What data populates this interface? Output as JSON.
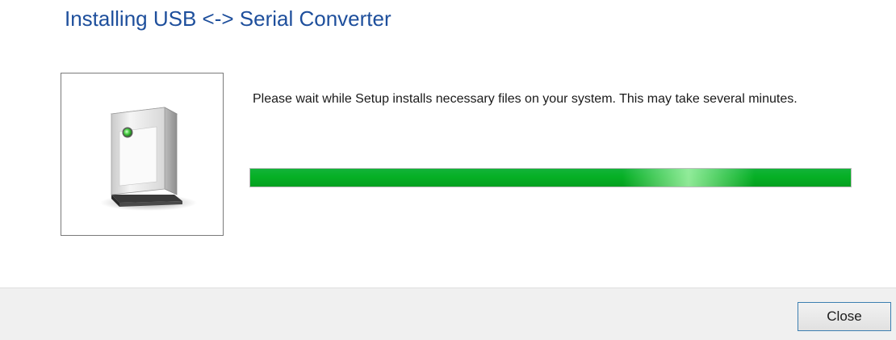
{
  "dialog": {
    "title": "Installing USB <-> Serial Converter",
    "message": "Please wait while Setup installs necessary files on your system. This may take several minutes.",
    "device_icon": "usb-device-icon",
    "progress": {
      "percent": 100,
      "color": "#06b025"
    },
    "footer": {
      "close_label": "Close"
    }
  }
}
